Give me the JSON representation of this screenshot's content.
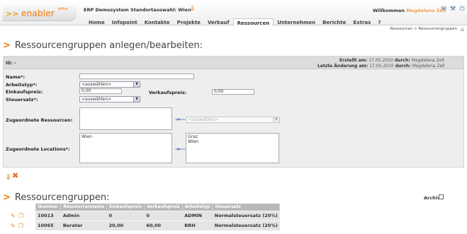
{
  "app": {
    "logo_text": "enabler",
    "logo_sup": "office",
    "system_info": "ERP Demosystem Standortauswahl: Wien",
    "welcome_label": "Willkommen",
    "welcome_user": "Magdalena Zell"
  },
  "nav": {
    "items": [
      "Home",
      "Infopoint",
      "Kontakte",
      "Projekte",
      "Verkauf",
      "Ressourcen",
      "Unternehmen",
      "Berichte",
      "Extras",
      "?"
    ],
    "active": "Ressourcen"
  },
  "breadcrumb": "Ressourcen > Ressourcengruppen",
  "form": {
    "title": "Ressourcengruppen anlegen/bearbeiten:",
    "id_label": "ID: -",
    "created_label": "Erstellt am:",
    "created_date": "17.05.2010",
    "created_by_label": "durch:",
    "created_by": "Magdalena Zell",
    "changed_label": "Letzte Änderung am:",
    "changed_date": "17.05.2010",
    "changed_by_label": "durch:",
    "changed_by": "Magdalena Zell",
    "name_label": "Name*:",
    "name_value": "",
    "arbeitstyp_label": "Arbeitstyp*:",
    "arbeitstyp_value": "<auswählen>",
    "einkaufspreis_label": "Einkaufspreis:",
    "einkaufspreis_value": "0,00",
    "verkaufspreis_label": "Verkaufspreis:",
    "verkaufspreis_value": "0,00",
    "steuersatz_label": "Steuersatz*:",
    "steuersatz_value": "<auswählen>",
    "ressourcen_label": "Zugeordnete Ressourcen:",
    "ressourcen_select": "<auswählen>",
    "locations_label": "Zugeordnete Locations*:",
    "locations_assigned": [
      "Wien"
    ],
    "locations_available": [
      "Graz",
      "Wien"
    ]
  },
  "list": {
    "title": "Ressourcengruppen:",
    "archiv_label": "Archiv",
    "archiv_checked": false,
    "columns": [
      "Nummer",
      "Ressourcenname",
      "Einkaufspreis",
      "Verkaufspreis",
      "Arbeitstyp",
      "Steuersatz"
    ],
    "rows": [
      [
        "10013",
        "Admin",
        "0",
        "0",
        "ADMIN",
        "Normalsteuersatz (20%)"
      ],
      [
        "10065",
        "Berater",
        "20,00",
        "60,00",
        "BRH",
        "Normalsteuersatz (20%)"
      ]
    ]
  },
  "icons": {
    "location": "pin-icon",
    "mail": "mail-icon",
    "tools": "tools-icon",
    "power": "power-icon",
    "home": "home-icon",
    "save": "save-icon",
    "cancel": "cancel-icon",
    "edit": "edit-icon",
    "copy": "copy-icon"
  },
  "colors": {
    "accent": "#f07a10",
    "user": "#f0a050",
    "panel": "#eeeeee",
    "table_header": "#b9b9b9"
  }
}
